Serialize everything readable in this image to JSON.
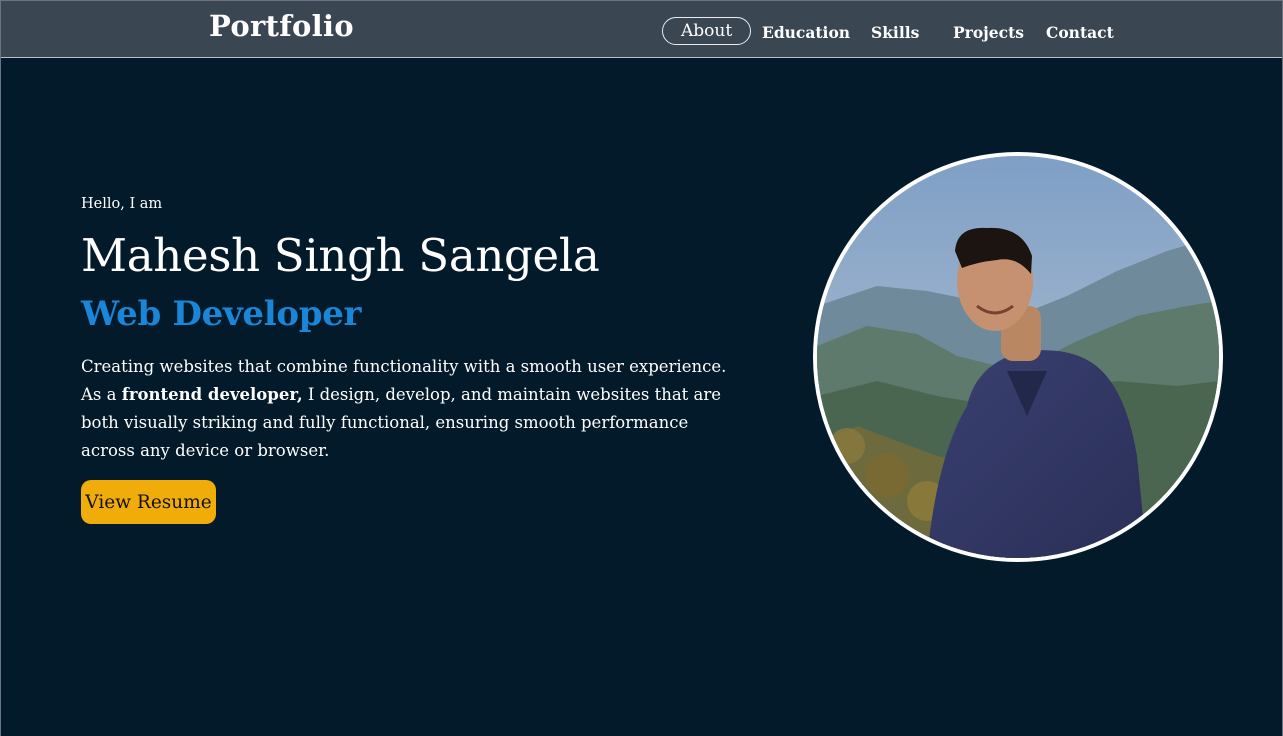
{
  "nav": {
    "brand": "Portfolio",
    "items": [
      {
        "label": "About"
      },
      {
        "label": "Education"
      },
      {
        "label": "Skills"
      },
      {
        "label": "Projects"
      },
      {
        "label": "Contact"
      }
    ]
  },
  "hero": {
    "greeting": "Hello, I am",
    "name": "Mahesh Singh Sangela",
    "role": "Web Developer",
    "line1": "Creating websites that combine functionality with a smooth user experience.",
    "line2_prefix": "As a ",
    "line2_bold": "frontend developer,",
    "line2_suffix": " I design, develop, and maintain websites that are both visually striking and fully functional, ensuring smooth performance across any device or browser.",
    "button_label": "View Resume"
  },
  "colors": {
    "background": "#031a2a",
    "navbar": "#3a4652",
    "accent": "#1a86d8",
    "button": "#f0ad0a"
  }
}
